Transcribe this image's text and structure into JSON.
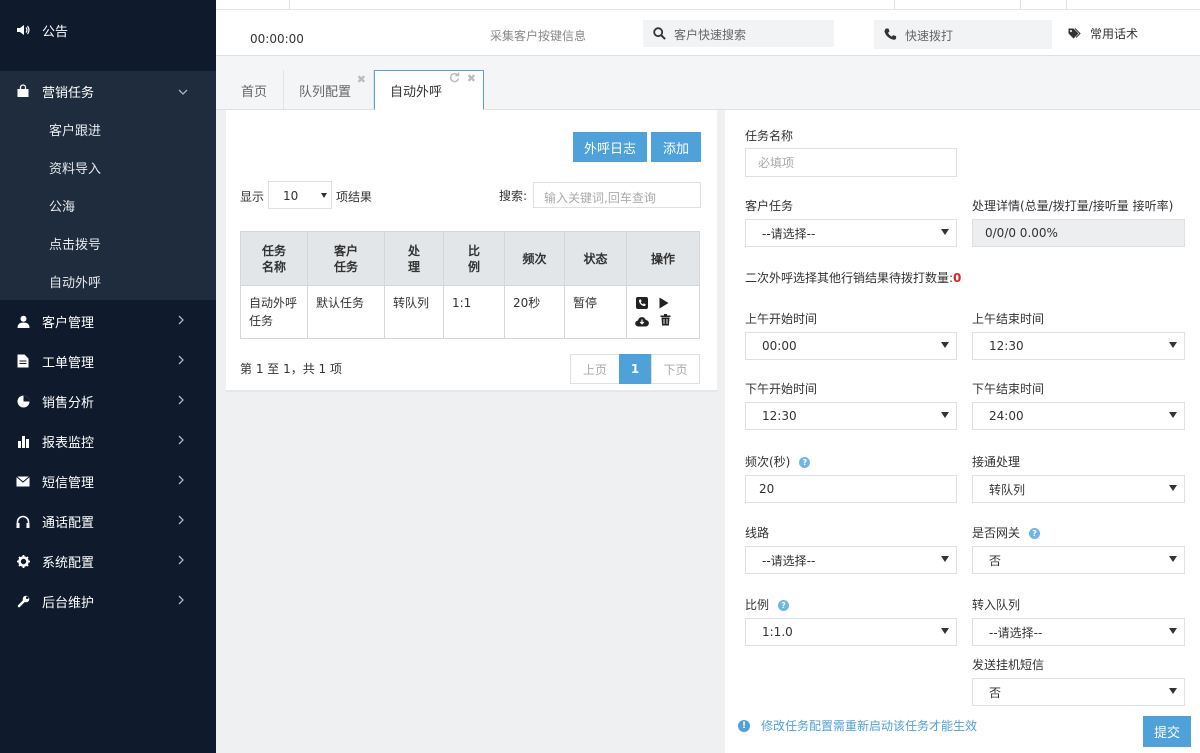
{
  "sidebar": {
    "notice": "公告",
    "marketing": {
      "label": "营销任务",
      "children": [
        "客户跟进",
        "资料导入",
        "公海",
        "点击拨号",
        "自动外呼"
      ]
    },
    "menus": [
      "客户管理",
      "工单管理",
      "销售分析",
      "报表监控",
      "短信管理",
      "通话配置",
      "系统配置",
      "后台维护"
    ]
  },
  "topbar": {
    "timer": "00:00:00",
    "collect": "采集客户按键信息",
    "search_placeholder": "客户快速搜索",
    "dial_placeholder": "快速拨打",
    "common_phrases": "常用话术"
  },
  "tabs": [
    "首页",
    "队列配置",
    "自动外呼"
  ],
  "left": {
    "log_button": "外呼日志",
    "add_button": "添加",
    "show_label": "显示",
    "page_size": "10",
    "results_label": "项结果",
    "search_label": "搜索:",
    "search_placeholder": "输入关键词,回车查询",
    "columns": [
      "任务名称",
      "客户任务",
      "处理",
      "比例",
      "频次",
      "状态",
      "操作"
    ],
    "rows": [
      {
        "name": "自动外呼任务",
        "task": "默认任务",
        "handle": "转队列",
        "ratio": "1:1",
        "freq": "20秒",
        "status": "暂停"
      }
    ],
    "summary": "第 1 至 1，共 1 项",
    "prev": "上页",
    "page": "1",
    "next": "下页"
  },
  "form": {
    "task_name_label": "任务名称",
    "task_name_placeholder": "必填项",
    "customer_task_label": "客户任务",
    "customer_task_value": "--请选择--",
    "detail_label": "处理详情(总量/拨打量/接听量 接听率)",
    "detail_value": "0/0/0  0.00%",
    "second_call_label": "二次外呼选择其他行销结果待拨打数量:",
    "second_call_count": "0",
    "am_start_label": "上午开始时间",
    "am_start_value": "00:00",
    "am_end_label": "上午结束时间",
    "am_end_value": "12:30",
    "pm_start_label": "下午开始时间",
    "pm_start_value": "12:30",
    "pm_end_label": "下午结束时间",
    "pm_end_value": "24:00",
    "freq_label": "频次(秒)",
    "freq_value": "20",
    "connect_label": "接通处理",
    "connect_value": "转队列",
    "line_label": "线路",
    "line_value": "--请选择--",
    "gateway_label": "是否网关",
    "gateway_value": "否",
    "ratio_label": "比例",
    "ratio_value": "1:1.0",
    "queue_label": "转入队列",
    "queue_value": "--请选择--",
    "sms_label": "发送挂机短信",
    "sms_value": "否",
    "notice": "修改任务配置需重新启动该任务才能生效",
    "submit": "提交"
  },
  "colors": {
    "sidebar": "#0f1b2c",
    "submenu": "#1f2c3d",
    "accent": "#4ea1d9",
    "alert": "#e02020"
  }
}
